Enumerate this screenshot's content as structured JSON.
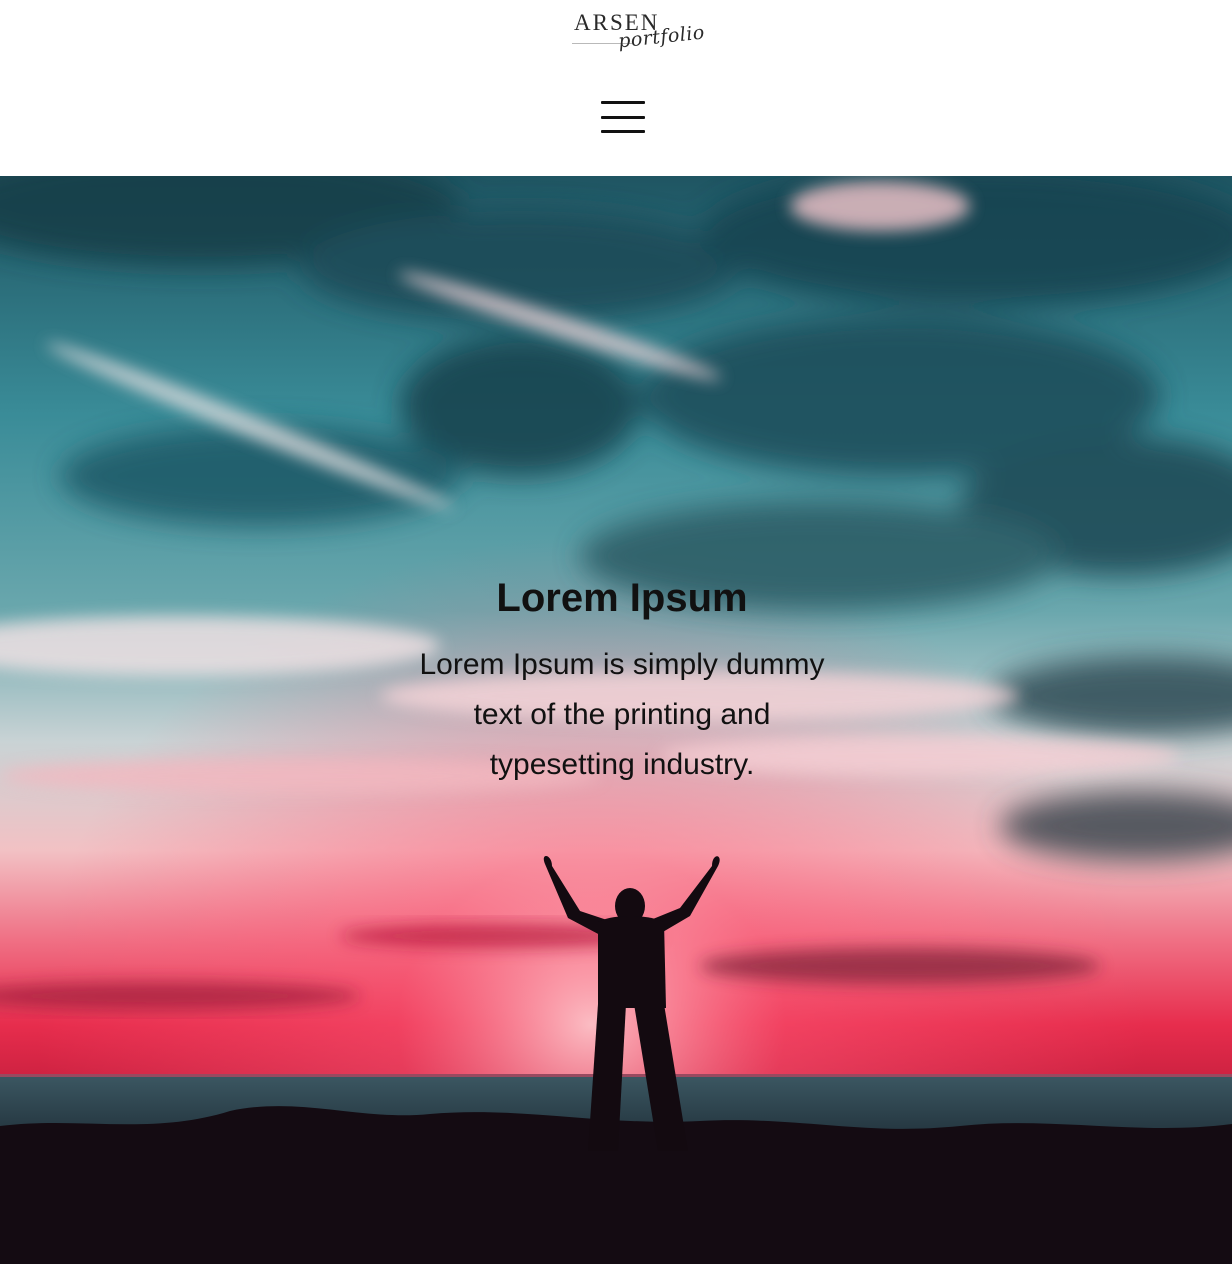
{
  "header": {
    "logo": {
      "wordmark": "ARSEN",
      "script": "portfolio"
    },
    "menu_icon": "hamburger-menu-icon"
  },
  "hero": {
    "title": "Lorem Ipsum",
    "body": "Lorem Ipsum is simply dummy text of the printing and typesetting industry.",
    "background_image": "sunset sky over sea with silhouette of person raising arms",
    "text_color": "#111111"
  },
  "colors": {
    "header_background": "#ffffff",
    "sky_teal": "#2f7f8e",
    "sunset_red": "#e8314f",
    "foreground_dark": "#140b12"
  }
}
